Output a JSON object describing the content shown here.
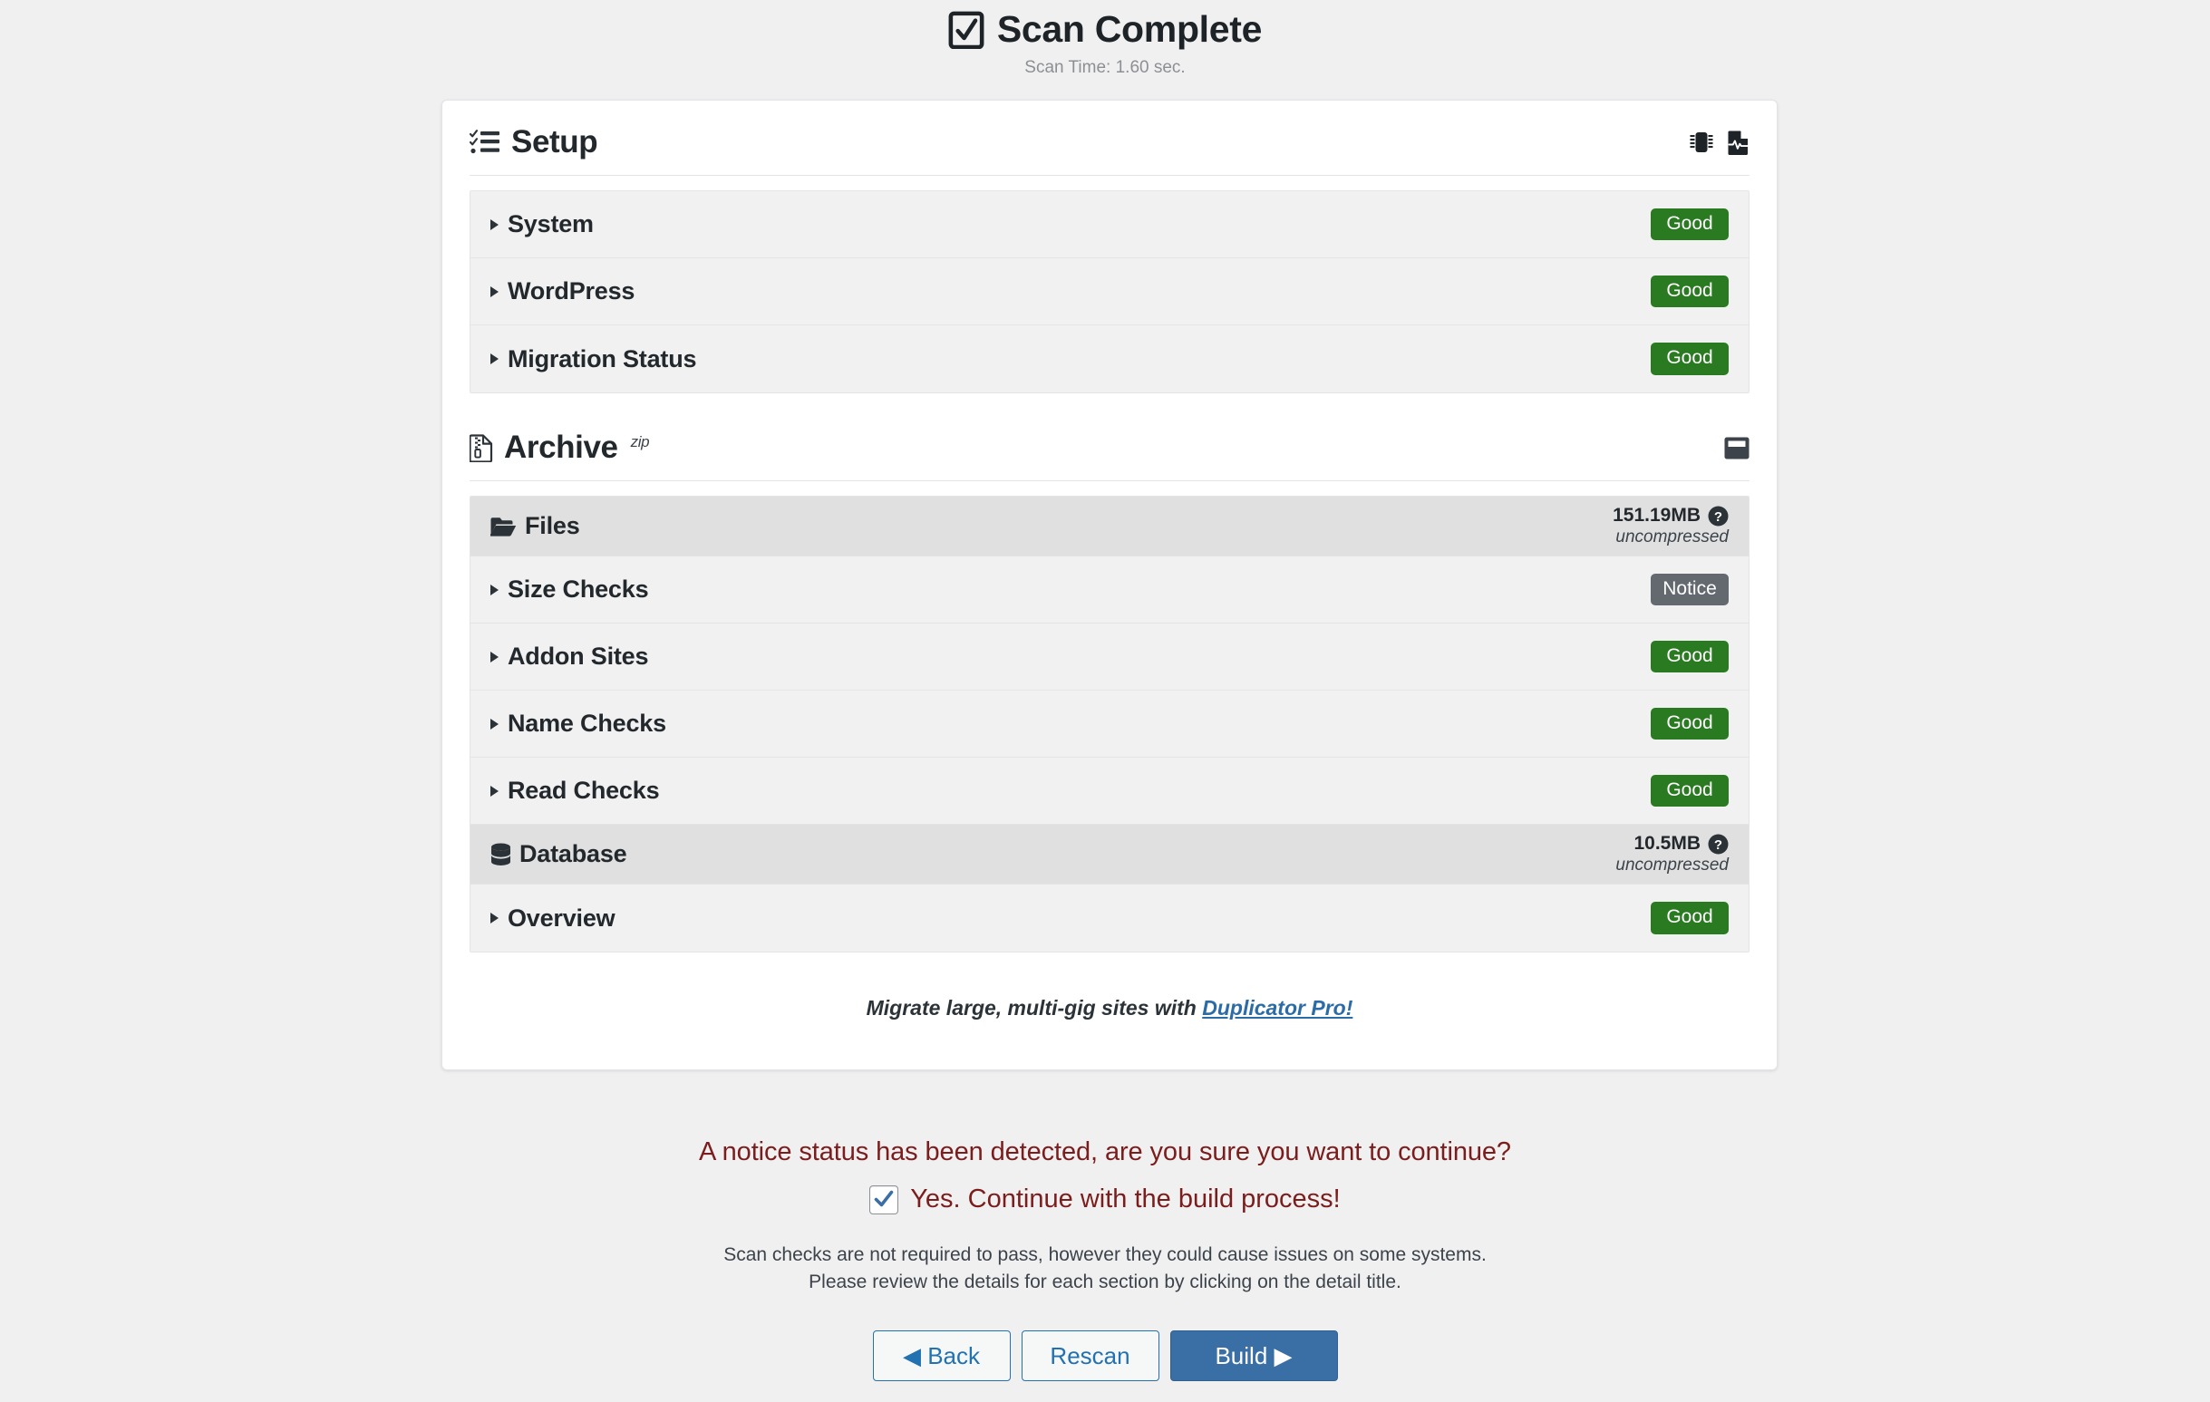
{
  "header": {
    "icon": "checkbox-checked-icon",
    "title": "Scan Complete",
    "scan_time": "Scan Time: 1.60 sec."
  },
  "setup": {
    "icon": "tasks-checklist-icon",
    "title": "Setup",
    "actions": [
      {
        "name": "microchip-icon",
        "label": ""
      },
      {
        "name": "file-waveform-icon",
        "label": ""
      }
    ],
    "rows": [
      {
        "label": "System",
        "status": "Good",
        "status_type": "good"
      },
      {
        "label": "WordPress",
        "status": "Good",
        "status_type": "good"
      },
      {
        "label": "Migration Status",
        "status": "Good",
        "status_type": "good"
      }
    ]
  },
  "archive": {
    "icon": "file-archive-icon",
    "title": "Archive",
    "format": "zip",
    "actions": [
      {
        "name": "window-save-icon",
        "label": ""
      }
    ],
    "groups": [
      {
        "name": "files",
        "icon": "folder-open-icon",
        "label": "Files",
        "size": "151.19MB",
        "size_note": "uncompressed",
        "help_icon": "question-circle-icon",
        "rows": [
          {
            "label": "Size Checks",
            "status": "Notice",
            "status_type": "notice"
          },
          {
            "label": "Addon Sites",
            "status": "Good",
            "status_type": "good"
          },
          {
            "label": "Name Checks",
            "status": "Good",
            "status_type": "good"
          },
          {
            "label": "Read Checks",
            "status": "Good",
            "status_type": "good"
          }
        ]
      },
      {
        "name": "database",
        "icon": "database-icon",
        "label": "Database",
        "size": "10.5MB",
        "size_note": "uncompressed",
        "help_icon": "question-circle-icon",
        "rows": [
          {
            "label": "Overview",
            "status": "Good",
            "status_type": "good"
          }
        ]
      }
    ]
  },
  "promo": {
    "text": "Migrate large, multi-gig sites with ",
    "link": "Duplicator Pro!"
  },
  "footer": {
    "notice_question": "A notice status has been detected, are you sure you want to continue?",
    "confirm_label": "Yes. Continue with the build process!",
    "confirm_checked": true,
    "help_line_1": "Scan checks are not required to pass, however they could cause issues on some systems.",
    "help_line_2": "Please review the details for each section by clicking on the detail title.",
    "buttons": {
      "back": "◀ Back",
      "rescan": "Rescan",
      "build": "Build ▶"
    }
  },
  "colors": {
    "good": "#2a7a21",
    "notice": "#646970",
    "notice_text": "#7b1d1d",
    "primary_button": "#3a6fa5",
    "link": "#2c6ca6",
    "page_background": "#f0f0f1"
  }
}
